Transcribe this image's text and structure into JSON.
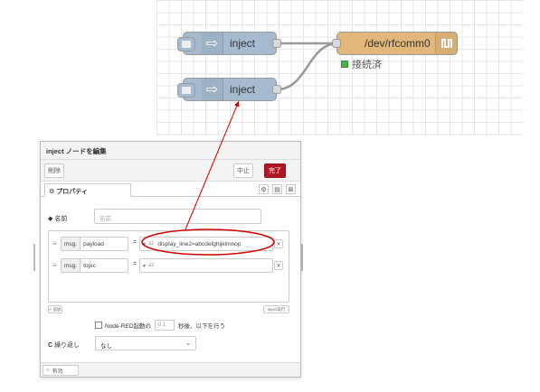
{
  "flow": {
    "inject_top": {
      "label": "inject"
    },
    "inject_bottom": {
      "label": "inject"
    },
    "serial_out": {
      "label": "/dev/rfcomm0",
      "status": "接続済"
    }
  },
  "dialog": {
    "title": "inject ノードを編集",
    "delete_label": "削除",
    "cancel_label": "中止",
    "done_label": "完了",
    "properties_tab": "プロパティ",
    "name_label": "名前",
    "name_placeholder": "名前",
    "props": [
      {
        "prefix": "msg.",
        "key": "payload",
        "type_marker": "az",
        "value": "display_line2=abcdefghijklmnop"
      },
      {
        "prefix": "msg.",
        "key": "topic",
        "type_marker": "az",
        "value": ""
      }
    ],
    "add_label": "+ 追加",
    "inject_now_label": "inject実行",
    "startup_prefix": "Node-RED起動の",
    "startup_delay": "0.1",
    "startup_suffix": "秒後、以下を行う",
    "repeat_label": "繰り返し",
    "repeat_value": "なし",
    "enabled_label": "有効"
  },
  "colors": {
    "inject": "#a6bbcf",
    "serial": "#e2b77a",
    "done_button": "#ad1625",
    "annotation": "#d40000"
  }
}
